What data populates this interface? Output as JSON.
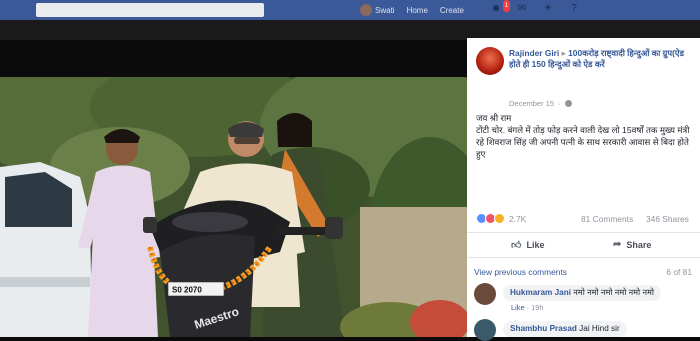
{
  "topbar": {
    "profile_name": "Swati",
    "nav_home": "Home",
    "nav_create": "Create",
    "notification_count": "1"
  },
  "post": {
    "author": "Rajinder Giri",
    "group": "100करोड़ राष्ट्वादी हिन्दुओं का ग्रुप(ऐड होते ही 150 हिन्दुओं को ऐड करें",
    "date": "December 15",
    "body_line1": "जय श्री राम",
    "body_line2": "टोंटी चोर. बंगले में तोड़ फोड़ करने वाली देख लो 15वर्षों तक मुख्य मंत्री रहे शिवराज सिंह जी अपनी पत्नी के साथ सरकारी आवास से बिदा होते हुए",
    "reaction_count": "2.7K",
    "comments_count": "81 Comments",
    "shares_count": "346 Shares",
    "like_label": "Like",
    "share_label": "Share",
    "view_previous": "View previous comments",
    "comment_position": "6 of 81"
  },
  "comments": [
    {
      "name": "Hukmaram Jani",
      "text": "नमो नमो नमो नमो नमो नमो",
      "like_label": "Like",
      "time": "19h"
    },
    {
      "name": "Shambhu Prasad",
      "text": "Jai Hind sir"
    }
  ],
  "photo": {
    "plate_text": "S0 2070",
    "scooter_brand": "Maestro"
  },
  "colors": {
    "facebook_blue": "#3b5998",
    "link_blue": "#365899",
    "meta_gray": "#90949c"
  }
}
